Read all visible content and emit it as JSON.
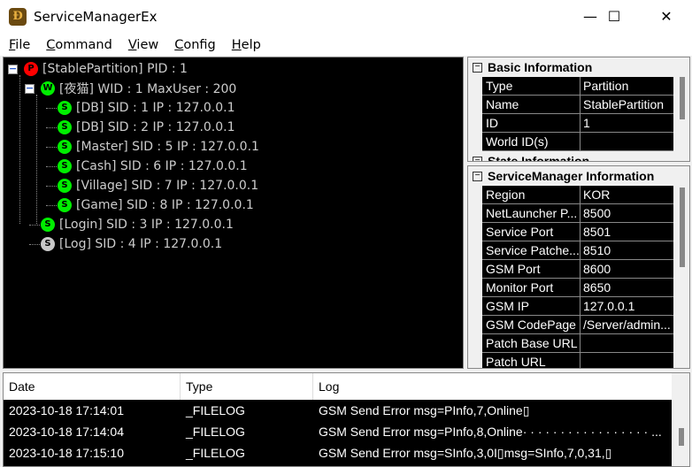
{
  "window": {
    "title": "ServiceManagerEx",
    "icon": "app-logo-icon",
    "controls": [
      "minimize",
      "maximize",
      "close"
    ]
  },
  "menu": [
    "File",
    "Command",
    "View",
    "Config",
    "Help"
  ],
  "tree": [
    {
      "label": "[StablePartition] PID : 1",
      "badge": "P",
      "color": "#ff0000",
      "level": 0,
      "expanded": true
    },
    {
      "label": "[夜猫] WID : 1 MaxUser : 200",
      "badge": "W",
      "color": "#00ee00",
      "level": 1,
      "expanded": true
    },
    {
      "label": "[DB] SID : 1 IP : 127.0.0.1",
      "badge": "S",
      "color": "#00ee00",
      "level": 2
    },
    {
      "label": "[DB] SID : 2 IP : 127.0.0.1",
      "badge": "S",
      "color": "#00ee00",
      "level": 2
    },
    {
      "label": "[Master] SID : 5 IP : 127.0.0.1",
      "badge": "S",
      "color": "#00ee00",
      "level": 2
    },
    {
      "label": "[Cash] SID : 6 IP : 127.0.0.1",
      "badge": "S",
      "color": "#00ee00",
      "level": 2
    },
    {
      "label": "[Village] SID : 7 IP : 127.0.0.1",
      "badge": "S",
      "color": "#00ee00",
      "level": 2
    },
    {
      "label": "[Game] SID : 8 IP : 127.0.0.1",
      "badge": "S",
      "color": "#00ee00",
      "level": 2
    },
    {
      "label": "[Login] SID : 3 IP : 127.0.0.1",
      "badge": "S",
      "color": "#00ee00",
      "level": 1
    },
    {
      "label": "[Log] SID : 4 IP : 127.0.0.1",
      "badge": "S",
      "color": "#c8c8c8",
      "level": 1
    }
  ],
  "basic": {
    "title": "Basic Information",
    "next_title": "State Information",
    "rows": [
      [
        "Type",
        "Partition"
      ],
      [
        "Name",
        "StablePartition"
      ],
      [
        "ID",
        "1"
      ],
      [
        "World ID(s)",
        ""
      ]
    ]
  },
  "sm": {
    "title": "ServiceManager Information",
    "rows": [
      [
        "Region",
        "KOR"
      ],
      [
        "NetLauncher P...",
        "8500"
      ],
      [
        "Service Port",
        "8501"
      ],
      [
        "Service Patche...",
        "8510"
      ],
      [
        "GSM Port",
        "8600"
      ],
      [
        "Monitor Port",
        "8650"
      ],
      [
        "GSM IP",
        "127.0.0.1"
      ],
      [
        "GSM CodePage",
        "/Server/admin..."
      ],
      [
        "Patch Base URL",
        ""
      ],
      [
        "Patch URL",
        ""
      ]
    ]
  },
  "log": {
    "headers": [
      "Date",
      "Type",
      "Log"
    ],
    "rows": [
      [
        "2023-10-18 17:14:01",
        "_FILELOG",
        "GSM Send Error msg=PInfo,7,Online▯"
      ],
      [
        "2023-10-18 17:14:04",
        "_FILELOG",
        "GSM Send Error msg=PInfo,8,Online· · · · · · · · · · · · · · · · · ..."
      ],
      [
        "2023-10-18 17:15:10",
        "_FILELOG",
        "GSM Send Error msg=SInfo,3,0I▯msg=SInfo,7,0,31,▯"
      ]
    ]
  }
}
